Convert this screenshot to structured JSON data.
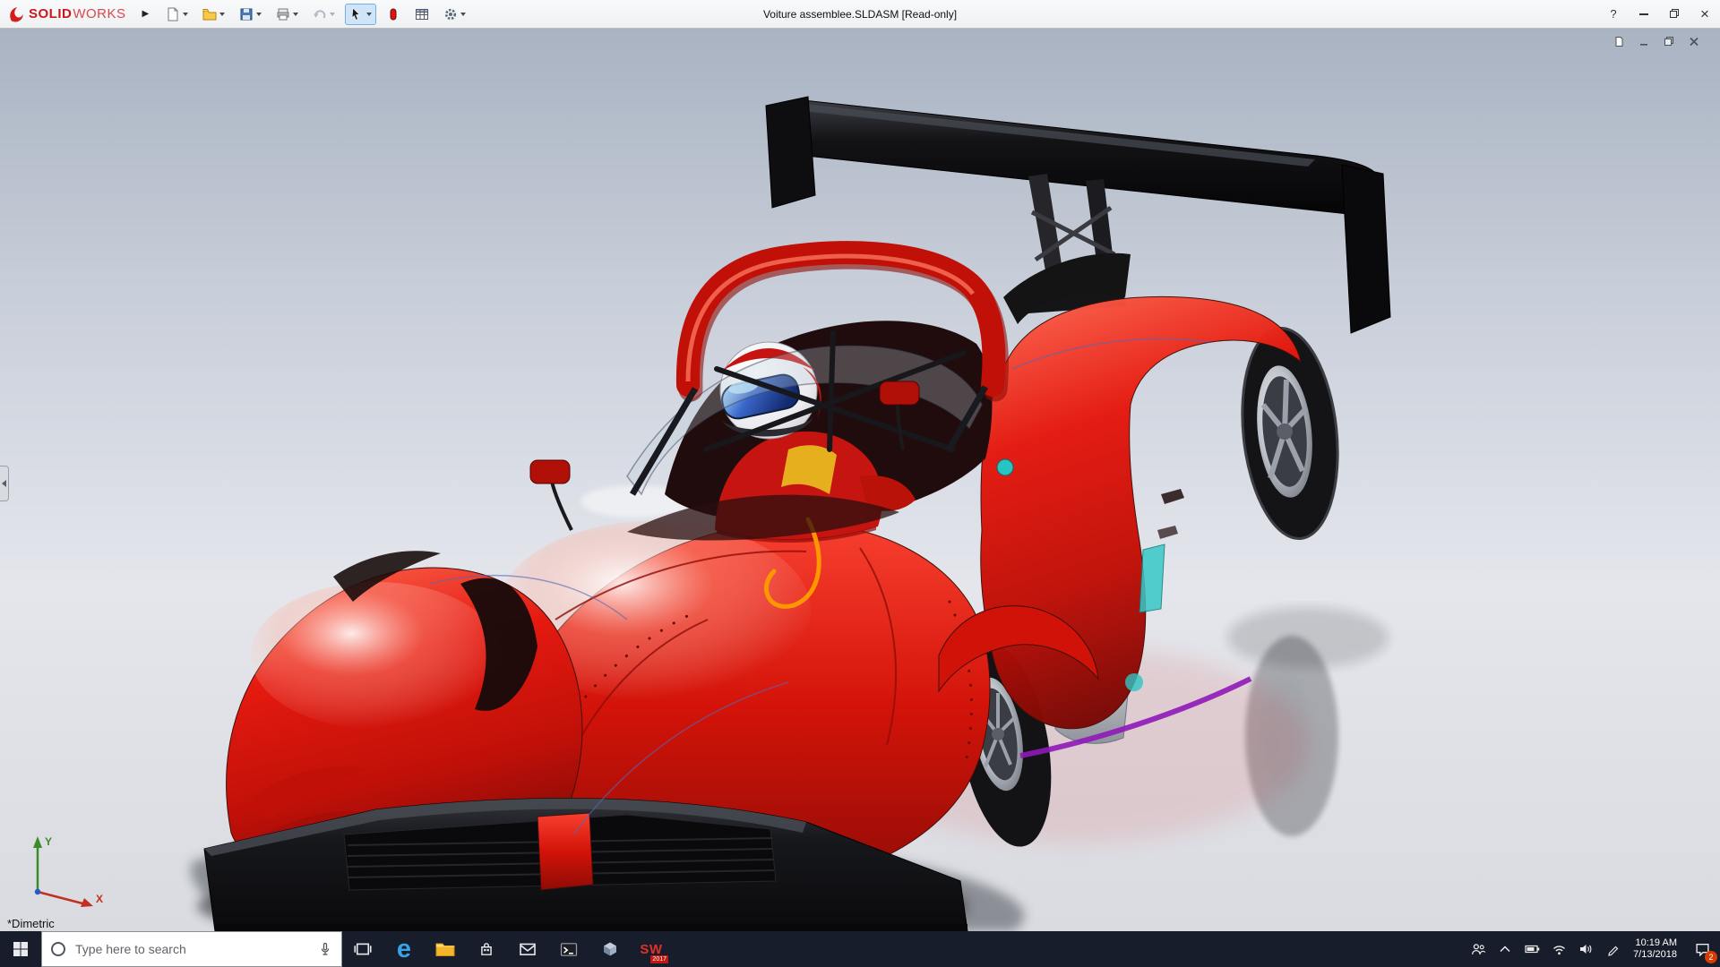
{
  "window": {
    "title": "Voiture assemblee.SLDASM [Read-only]",
    "help_label": "?"
  },
  "logo": {
    "brand_icon": "dassault-ds-icon",
    "solid": "SOLID",
    "works": "WORKS",
    "menu_arrow": "▶"
  },
  "toolbar": {
    "icons": [
      "new-document",
      "open-folder",
      "save",
      "print",
      "undo",
      "select-arrow",
      "appearance",
      "design-table",
      "options-gear"
    ]
  },
  "viewport": {
    "view_label": "*Dimetric",
    "triad": {
      "x": "X",
      "y": "Y"
    },
    "child_controls": [
      "document",
      "minimize",
      "restore",
      "close"
    ]
  },
  "taskbar": {
    "search": {
      "placeholder": "Type here to search"
    },
    "apps": [
      "start",
      "cortana-search",
      "microphone",
      "task-view",
      "edge",
      "file-explorer",
      "store",
      "mail",
      "terminal",
      "cube-app",
      "solidworks-2017"
    ],
    "edge_letter": "e",
    "solidworks_icon": {
      "letters": "SW",
      "year": "2017"
    },
    "tray": {
      "icons": [
        "people",
        "hidden-icons-chevron",
        "battery",
        "network",
        "volume",
        "pen"
      ],
      "time": "10:19 AM",
      "date": "7/13/2018",
      "notification_count": "2"
    }
  },
  "colors": {
    "titlebar_bg": "#eef0f2",
    "taskbar_bg": "#171d2b",
    "badge_orange": "#d83b01",
    "viewport_top": "#a9b3c2",
    "viewport_mid": "#c9cfda",
    "viewport_low": "#e4e6ec",
    "viewport_floor": "#d9dbe1",
    "car_red": "#d8150f",
    "car_red_dark": "#8a0c08",
    "car_red_light": "#ff6f5a",
    "wing_black": "#0c0c0e",
    "rim_silver": "#c4c7ce",
    "helmet_white": "#f2f2f4",
    "visor_blue": "#2a4fa8",
    "accent_teal": "#32c6c6",
    "accent_orange": "#ff9800",
    "accent_purple": "#9018b8"
  }
}
